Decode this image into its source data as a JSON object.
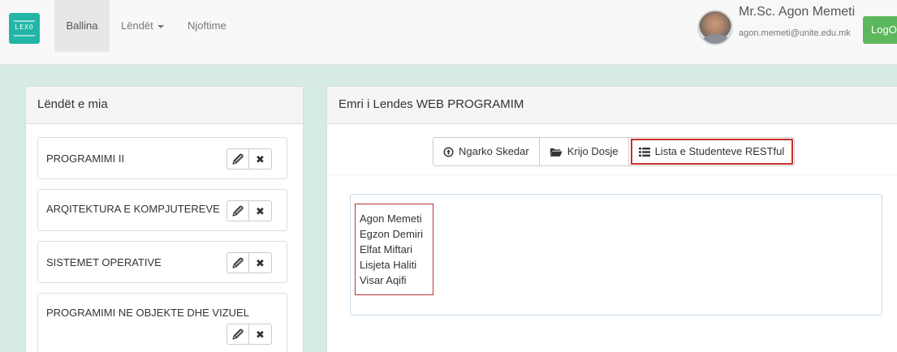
{
  "navbar": {
    "logo_text": "LEXO",
    "items": [
      {
        "label": "Ballina",
        "active": true
      },
      {
        "label": "Lëndët",
        "dropdown": true
      },
      {
        "label": "Njoftime"
      }
    ],
    "user": {
      "name": "Mr.Sc. Agon Memeti",
      "email": "agon.memeti@unite.edu.mk"
    },
    "logout_label": "LogO"
  },
  "left_panel": {
    "title": "Lëndët e mia",
    "subjects": [
      {
        "name": "PROGRAMIMI II",
        "edit_icon": "edit-icon",
        "delete_icon": "close-icon"
      },
      {
        "name": "ARQITEKTURA E KOMPJUTEREVE",
        "edit_icon": "edit-icon",
        "delete_icon": "close-icon"
      },
      {
        "name": "SISTEMET OPERATIVE",
        "edit_icon": "edit-icon",
        "delete_icon": "close-icon"
      },
      {
        "name": "PROGRAMIMI NE OBJEKTE DHE VIZUEL",
        "edit_icon": "edit-icon",
        "delete_icon": "close-icon"
      }
    ]
  },
  "right_panel": {
    "title": "Emri i Lendes WEB PROGRAMIM",
    "toolbar": [
      {
        "label": "Ngarko Skedar",
        "icon": "upload-circle-icon"
      },
      {
        "label": "Krijo Dosje",
        "icon": "folder-open-icon"
      },
      {
        "label": "Lista e Studenteve RESTful",
        "icon": "list-icon",
        "highlighted": true
      }
    ],
    "students": [
      "Agon Memeti",
      "Egzon Demiri",
      "Elfat Miftari",
      "Lisjeta Haliti",
      "Visar Aqifi"
    ]
  },
  "colors": {
    "background": "#d6ebe6",
    "logo": "#23b6a7",
    "logout": "#5cb85c",
    "highlight_border": "#c9302c"
  }
}
